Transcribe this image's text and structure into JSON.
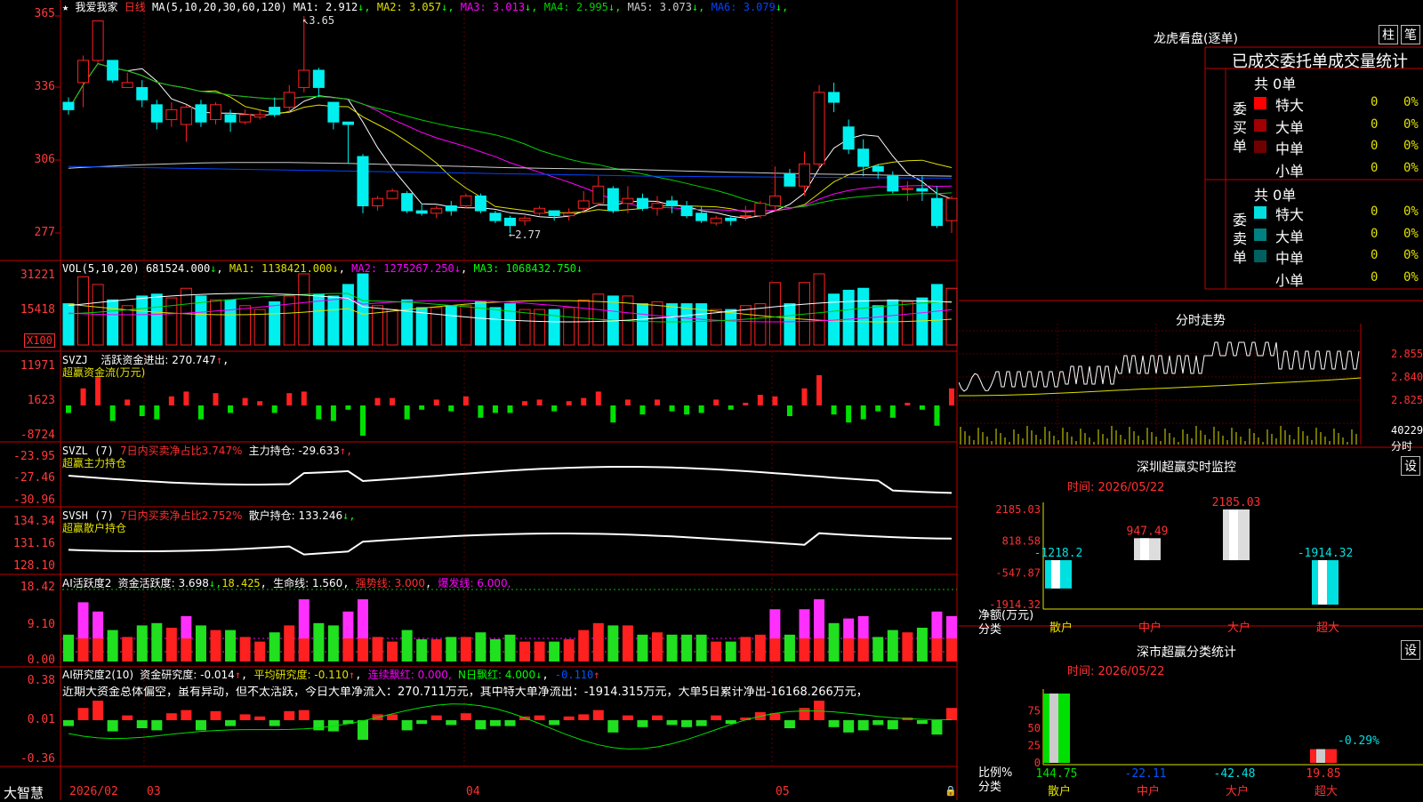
{
  "colors": {
    "up": "#ff2020",
    "down": "#00f0f0",
    "frame": "#c00000",
    "ma1": "#ffffff",
    "ma2": "#e0e000",
    "ma3": "#ff00ff",
    "ma4": "#00d000",
    "ma5": "#cccccc",
    "ma6": "#0044ff"
  },
  "main": {
    "star": "★",
    "stock": "我爱我家",
    "period": "日线",
    "ma_title": "MA(5,10,20,30,60,120)",
    "ma": [
      {
        "label": "MA1: ",
        "value": "2.912",
        "arrow": "↓",
        "color": "#ffffff"
      },
      {
        "label": "MA2: ",
        "value": "3.057",
        "arrow": "↓",
        "color": "#e0e000"
      },
      {
        "label": "MA3: ",
        "value": "3.013",
        "arrow": "↓",
        "color": "#ff00ff"
      },
      {
        "label": "MA4: ",
        "value": "2.995",
        "arrow": "↓",
        "color": "#00d000"
      },
      {
        "label": "MA5: ",
        "value": "3.073",
        "arrow": "↓",
        "color": "#cccccc"
      },
      {
        "label": "MA6: ",
        "value": "3.079",
        "arrow": "↓",
        "color": "#0044ff"
      }
    ],
    "high_note": "3.65",
    "low_note": "←2.77",
    "ylabels": [
      "365",
      "336",
      "306",
      "277"
    ]
  },
  "vol": {
    "title": "VOL(5,10,20)",
    "value": "681524.000",
    "arrow": "↓",
    "ma1": "MA1: 1138421.000↓",
    "ma2": "MA2: 1275267.250↓",
    "ma3": "MA3: 1068432.750↓",
    "ylabels": [
      "31221",
      "15418"
    ],
    "unit": "X100"
  },
  "svzj": {
    "title": "SVZJ",
    "line": "活跃资金进出: 270.747",
    "arrow": "↑",
    "sub": "超赢资金流(万元)",
    "ylabels": [
      "11971",
      "1623",
      "-8724"
    ]
  },
  "svzl": {
    "title": "SVZL (7)",
    "ratio": "7日内买卖净占比3.747%",
    "main": "主力持仓: -29.633",
    "arrow": "↑,",
    "sub": "超赢主力持仓",
    "ylabels": [
      "-23.95",
      "-27.46",
      "-30.96"
    ]
  },
  "svsh": {
    "title": "SVSH (7)",
    "ratio": "7日内买卖净占比2.752%",
    "main": "散户持仓: 133.246",
    "arrow": "↓,",
    "sub": "超赢散户持仓",
    "ylabels": [
      "134.34",
      "131.16",
      "128.10"
    ]
  },
  "ai": {
    "title": "AI活跃度2",
    "a": "资金活跃度: 3.698",
    "a_arrow": "↓,",
    "b": "18.425",
    "c": "生命线: 1.560",
    "d": "强势线: 3.000",
    "e": "爆发线: 6.000,",
    "ylabels": [
      "18.42",
      "9.10",
      "0.00"
    ]
  },
  "ai2": {
    "title": "AI研究度2(10)",
    "a": "资金研究度: -0.014",
    "a_arrow": "↑",
    "b": "平均研究度: -0.110",
    "b_arrow": "↑",
    "c": "连续飘红: 0.000,",
    "d": "N日飘红: 4.000",
    "d_arrow": "↓",
    "e": "-0.110",
    "e_arrow": "↑",
    "comment": "近期大资金总体偏空，虽有异动，但不太活跃，今日大单净流入：270.711万元，其中特大单净流出：-1914.315万元，大单5日累计净出-16168.266万元，",
    "ylabels": [
      "0.38",
      "0.01",
      "-0.36"
    ]
  },
  "xaxis": {
    "brand": "大智慧",
    "labels": [
      "2026/02",
      "03",
      "04",
      "05"
    ]
  },
  "dragon": {
    "title": "龙虎看盘(逐单)",
    "btn1": "柱",
    "btn2": "笔",
    "header": "已成交委托单成交量统计",
    "buy": {
      "side": "委买单",
      "total": "共 0单",
      "rows": [
        {
          "name": "特大",
          "n": "0",
          "p": "0%",
          "color": "#ff0000"
        },
        {
          "name": "大单",
          "n": "0",
          "p": "0%",
          "color": "#a00000"
        },
        {
          "name": "中单",
          "n": "0",
          "p": "0%",
          "color": "#700000"
        },
        {
          "name": "小单",
          "n": "0",
          "p": "0%",
          "color": ""
        }
      ]
    },
    "sell": {
      "side": "委卖单",
      "total": "共 0单",
      "rows": [
        {
          "name": "特大",
          "n": "0",
          "p": "0%",
          "color": "#00e0e0"
        },
        {
          "name": "大单",
          "n": "0",
          "p": "0%",
          "color": "#008080"
        },
        {
          "name": "中单",
          "n": "0",
          "p": "0%",
          "color": "#006060"
        },
        {
          "name": "小单",
          "n": "0",
          "p": "0%",
          "color": ""
        }
      ]
    }
  },
  "fenshi": {
    "title": "分时走势",
    "ylabels": [
      "2.855",
      "2.840",
      "2.825"
    ],
    "vol_label": "40229",
    "vol_unit": "分时"
  },
  "monitor": {
    "title": "深圳超赢实时监控",
    "btn": "设",
    "time": "时间: 2026/05/22",
    "ylabels": [
      "2185.03",
      "818.58",
      "-547.87",
      "-1914.32"
    ],
    "ylabel_name": "净额(万元)",
    "xname": "分类",
    "bars": [
      {
        "cat": "散户",
        "value": -1218.2,
        "label": "-1218.2"
      },
      {
        "cat": "中户",
        "value": 947.49,
        "label": "947.49"
      },
      {
        "cat": "大户",
        "value": 2185.03,
        "label": "2185.03"
      },
      {
        "cat": "超大",
        "value": -1914.32,
        "label": "-1914.32"
      }
    ]
  },
  "classify": {
    "title": "深市超赢分类统计",
    "btn": "设",
    "time": "时间: 2026/05/22",
    "ylabels": [
      "75",
      "50",
      "25",
      "0"
    ],
    "ylabel_name": "比例%",
    "xname": "分类",
    "bars": [
      {
        "cat": "散户",
        "value": 144.75,
        "label": "144.75"
      },
      {
        "cat": "中户",
        "value": -22.11,
        "label": "-22.11"
      },
      {
        "cat": "大户",
        "value": -42.48,
        "label": "-42.48"
      },
      {
        "cat": "超大",
        "value": 19.85,
        "label": "19.85"
      }
    ],
    "annot": "-0.29%"
  },
  "chart_data": [
    {
      "type": "candlestick",
      "title": "我爱我家 日线",
      "ylim": [
        2.77,
        3.65
      ],
      "x_labels": [
        "2026/02",
        "03",
        "04",
        "05"
      ],
      "high": 3.65,
      "low": 2.77,
      "candles": [
        [
          3.3,
          3.27,
          3.32,
          3.25
        ],
        [
          3.38,
          3.47,
          3.49,
          3.28
        ],
        [
          3.47,
          3.63,
          3.63,
          3.46
        ],
        [
          3.47,
          3.39,
          3.47,
          3.38
        ],
        [
          3.36,
          3.38,
          3.42,
          3.36
        ],
        [
          3.36,
          3.31,
          3.39,
          3.28
        ],
        [
          3.29,
          3.22,
          3.31,
          3.19
        ],
        [
          3.23,
          3.27,
          3.3,
          3.2
        ],
        [
          3.21,
          3.28,
          3.29,
          3.14
        ],
        [
          3.29,
          3.22,
          3.31,
          3.2
        ],
        [
          3.23,
          3.29,
          3.3,
          3.21
        ],
        [
          3.25,
          3.22,
          3.27,
          3.18
        ],
        [
          3.22,
          3.25,
          3.27,
          3.21
        ],
        [
          3.24,
          3.25,
          3.27,
          3.23
        ],
        [
          3.28,
          3.25,
          3.32,
          3.24
        ],
        [
          3.28,
          3.34,
          3.37,
          3.26
        ],
        [
          3.36,
          3.43,
          3.65,
          3.34
        ],
        [
          3.43,
          3.36,
          3.44,
          3.32
        ],
        [
          3.3,
          3.22,
          3.3,
          3.19
        ],
        [
          3.22,
          3.21,
          3.22,
          3.05
        ],
        [
          3.08,
          2.88,
          3.09,
          2.85
        ],
        [
          2.88,
          2.91,
          2.92,
          2.86
        ],
        [
          2.91,
          2.94,
          2.95,
          2.91
        ],
        [
          2.93,
          2.86,
          2.94,
          2.85
        ],
        [
          2.86,
          2.85,
          2.89,
          2.84
        ],
        [
          2.85,
          2.87,
          2.88,
          2.83
        ],
        [
          2.88,
          2.86,
          2.9,
          2.84
        ],
        [
          2.88,
          2.92,
          2.93,
          2.87
        ],
        [
          2.92,
          2.86,
          2.93,
          2.85
        ],
        [
          2.85,
          2.82,
          2.86,
          2.81
        ],
        [
          2.83,
          2.8,
          2.84,
          2.77
        ],
        [
          2.82,
          2.83,
          2.84,
          2.8
        ],
        [
          2.85,
          2.87,
          2.88,
          2.84
        ],
        [
          2.86,
          2.84,
          2.86,
          2.82
        ],
        [
          2.84,
          2.85,
          2.87,
          2.82
        ],
        [
          2.87,
          2.9,
          2.94,
          2.85
        ],
        [
          2.89,
          2.96,
          3.0,
          2.88
        ],
        [
          2.95,
          2.86,
          2.96,
          2.85
        ],
        [
          2.89,
          2.91,
          2.96,
          2.85
        ],
        [
          2.91,
          2.87,
          2.93,
          2.86
        ],
        [
          2.87,
          2.89,
          2.92,
          2.84
        ],
        [
          2.9,
          2.88,
          2.92,
          2.85
        ],
        [
          2.88,
          2.84,
          2.9,
          2.83
        ],
        [
          2.85,
          2.82,
          2.88,
          2.81
        ],
        [
          2.81,
          2.83,
          2.84,
          2.8
        ],
        [
          2.83,
          2.82,
          2.84,
          2.8
        ],
        [
          2.84,
          2.84,
          2.88,
          2.82
        ],
        [
          2.84,
          2.89,
          2.9,
          2.83
        ],
        [
          2.88,
          2.92,
          3.04,
          2.86
        ],
        [
          3.01,
          2.96,
          3.03,
          2.96
        ],
        [
          2.96,
          3.05,
          3.1,
          2.92
        ],
        [
          3.05,
          3.34,
          3.37,
          3.03
        ],
        [
          3.34,
          3.3,
          3.38,
          3.26
        ],
        [
          3.2,
          3.11,
          3.23,
          3.09
        ],
        [
          3.11,
          3.04,
          3.15,
          3.0
        ],
        [
          3.04,
          3.02,
          3.05,
          2.99
        ],
        [
          3.0,
          2.94,
          3.02,
          2.93
        ],
        [
          2.95,
          2.95,
          2.98,
          2.9
        ],
        [
          2.95,
          2.94,
          3.0,
          2.9
        ],
        [
          2.91,
          2.8,
          2.96,
          2.79
        ],
        [
          2.82,
          2.91,
          2.92,
          2.77
        ]
      ]
    },
    {
      "type": "bar",
      "title": "VOL(5,10,20)",
      "unit": "X100",
      "ylim": [
        0,
        31221
      ]
    },
    {
      "type": "bar",
      "title": "深圳超赢实时监控",
      "categories": [
        "散户",
        "中户",
        "大户",
        "超大"
      ],
      "values": [
        -1218.2,
        947.49,
        2185.03,
        -1914.32
      ],
      "ylabel": "净额(万元)",
      "xlabel": "分类",
      "ylim": [
        -1914.32,
        2185.03
      ]
    },
    {
      "type": "bar",
      "title": "深市超赢分类统计",
      "categories": [
        "散户",
        "中户",
        "大户",
        "超大"
      ],
      "values": [
        144.75,
        -22.11,
        -42.48,
        19.85
      ],
      "ylabel": "比例%",
      "xlabel": "分类",
      "ylim": [
        0,
        75
      ]
    }
  ]
}
